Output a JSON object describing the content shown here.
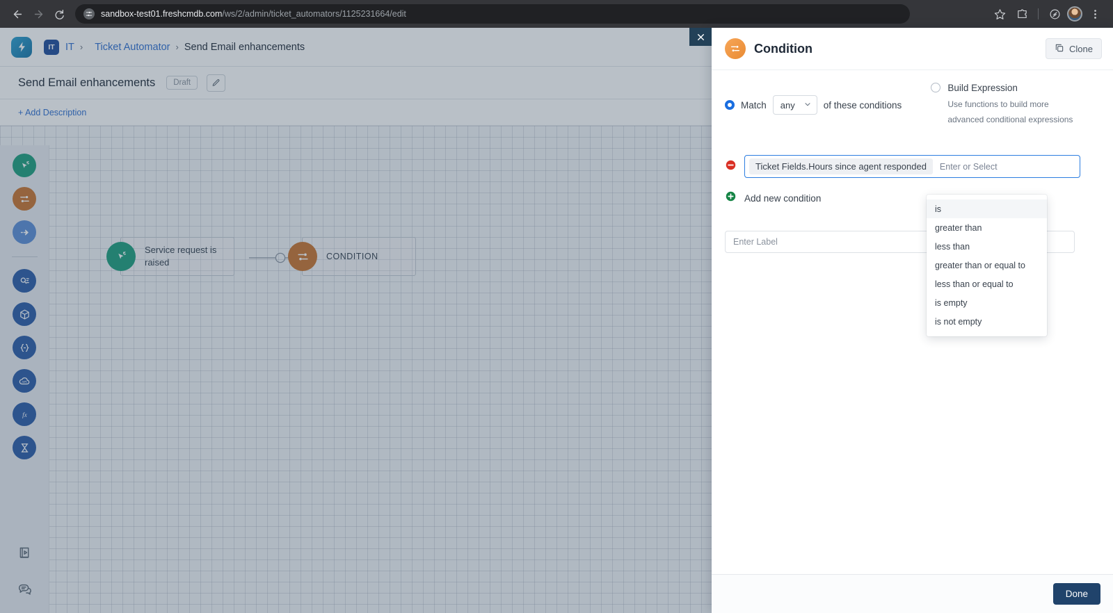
{
  "browser": {
    "back_icon": "back-arrow-icon",
    "forward_icon": "forward-arrow-icon",
    "reload_icon": "reload-icon",
    "site_info_icon": "site-settings-icon",
    "url_host": "sandbox-test01.freshcmdb.com",
    "url_path": "/ws/2/admin/ticket_automators/1125231664/edit",
    "bookmark_icon": "star-icon",
    "extensions_icon": "extensions-puzzle-icon",
    "shield_icon": "shield-leaf-icon",
    "avatar_icon": "profile-avatar",
    "menu_icon": "three-dot-menu-icon"
  },
  "breadcrumb": {
    "logo_icon": "freshworks-lightning-logo",
    "workspace_badge": "IT",
    "items": [
      {
        "label": "IT",
        "type": "link"
      },
      {
        "label": "Ticket Automator",
        "type": "link"
      },
      {
        "label": "Send Email enhancements",
        "type": "current"
      }
    ],
    "separator": "›"
  },
  "page": {
    "title": "Send Email enhancements",
    "status_badge": "Draft",
    "edit_icon": "pencil-icon",
    "add_description": "+ Add Description"
  },
  "palette": {
    "items": [
      {
        "name": "trigger",
        "icon": "cursor-click-icon",
        "color": "#1d9e7d"
      },
      {
        "name": "condition",
        "icon": "sliders-filter-icon",
        "color": "#c8742f"
      },
      {
        "name": "action",
        "icon": "arrow-right-icon",
        "color": "#5b8dd6"
      },
      {
        "name": "reader",
        "icon": "search-list-icon",
        "color": "#2b5ca8"
      },
      {
        "name": "asset",
        "icon": "cube-icon",
        "color": "#2b5ca8"
      },
      {
        "name": "expand",
        "icon": "braces-expand-icon",
        "color": "#2b5ca8"
      },
      {
        "name": "api",
        "icon": "api-cloud-icon",
        "color": "#2b5ca8"
      },
      {
        "name": "function",
        "icon": "fx-function-icon",
        "color": "#2b5ca8"
      },
      {
        "name": "timer",
        "icon": "hourglass-icon",
        "color": "#2b5ca8"
      }
    ],
    "bottom": [
      {
        "name": "guide",
        "icon": "book-play-icon"
      },
      {
        "name": "support-chat",
        "icon": "chat-bubbles-icon"
      }
    ]
  },
  "canvas": {
    "nodes": [
      {
        "label": "Service request is raised",
        "icon": "cursor-click-icon",
        "color": "#1d9e7d"
      },
      {
        "label": "CONDITION",
        "icon": "sliders-filter-icon",
        "color": "#c8742f"
      }
    ]
  },
  "panel": {
    "close_icon": "close-icon",
    "header_icon": "condition-sliders-icon",
    "title": "Condition",
    "clone_label": "Clone",
    "clone_icon": "copy-icon",
    "match": {
      "selected": true,
      "prefix": "Match",
      "dropdown_value": "any",
      "dropdown_icon": "chevron-down-icon",
      "suffix": "of these conditions"
    },
    "build_expression": {
      "selected": false,
      "title": "Build Expression",
      "subtitle": "Use functions to build more advanced conditional expressions"
    },
    "condition_row": {
      "remove_icon": "minus-circle-icon",
      "field_chip": "Ticket Fields.Hours since agent responded",
      "operator_placeholder": "Enter or Select"
    },
    "add_condition": {
      "icon": "plus-circle-icon",
      "label": "Add new condition"
    },
    "label_input": {
      "placeholder": "Enter Label"
    },
    "operator_dropdown": {
      "options": [
        "is",
        "greater than",
        "less than",
        "greater than or equal to",
        "less than or equal to",
        "is empty",
        "is not empty"
      ],
      "highlighted": "is"
    },
    "footer": {
      "done_label": "Done"
    }
  },
  "colors": {
    "accent_blue": "#1a6ee0",
    "link_blue": "#2f6fd0",
    "condition_orange": "#e98b33",
    "trigger_teal": "#1d9e7d",
    "done_navy": "#20436b",
    "remove_red": "#d93025",
    "add_green": "#158445"
  }
}
